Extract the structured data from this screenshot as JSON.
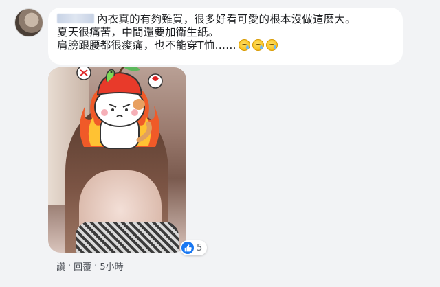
{
  "comment": {
    "author": "",
    "lines": [
      "內衣真的有夠難買，很多好看可愛的根本沒做這麼大。",
      "夏天很痛苦，中間還要加衛生紙。",
      "肩膀跟腰都很痠痛，也不能穿T恤……"
    ],
    "emoji_icons": [
      "sad-sweat-emoji",
      "sad-sweat-emoji",
      "sad-sweat-emoji"
    ],
    "emoji_color": "#f5b400"
  },
  "reactions": {
    "icon": "like-icon",
    "count": "5",
    "color": "#1877f2"
  },
  "actions": {
    "like_label": "讚",
    "reply_label": "回覆",
    "separator": "·",
    "time": "5小時"
  }
}
